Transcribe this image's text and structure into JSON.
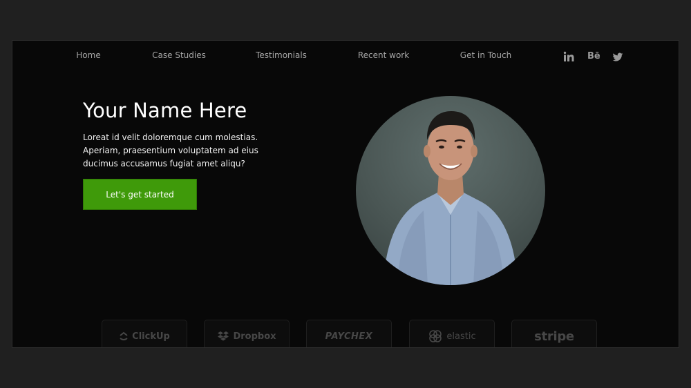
{
  "nav": {
    "items": [
      {
        "label": "Home"
      },
      {
        "label": "Case Studies"
      },
      {
        "label": "Testimonials"
      },
      {
        "label": "Recent work"
      },
      {
        "label": "Get in Touch"
      }
    ],
    "social": {
      "linkedin_label": "in",
      "behance_label": "Bē",
      "twitter_icon": "twitter-icon"
    }
  },
  "hero": {
    "title": "Your Name Here",
    "description": "Loreat id velit doloremque cum molestias. Aperiam, praesentium voluptatem ad eius ducimus accusamus fugiat amet aliqu?",
    "cta_label": "Let's get started",
    "cta_color": "#3f9a0a"
  },
  "logos": [
    {
      "name": "ClickUp",
      "icon": "clickup-icon"
    },
    {
      "name": "Dropbox",
      "icon": "dropbox-icon"
    },
    {
      "name": "PAYCHEX",
      "icon": ""
    },
    {
      "name": "elastic",
      "icon": "elastic-icon"
    },
    {
      "name": "stripe",
      "icon": ""
    }
  ],
  "colors": {
    "page_background": "#202020",
    "frame_background": "#080808",
    "nav_text": "#a6a6a6",
    "logo_muted": "#474747"
  }
}
